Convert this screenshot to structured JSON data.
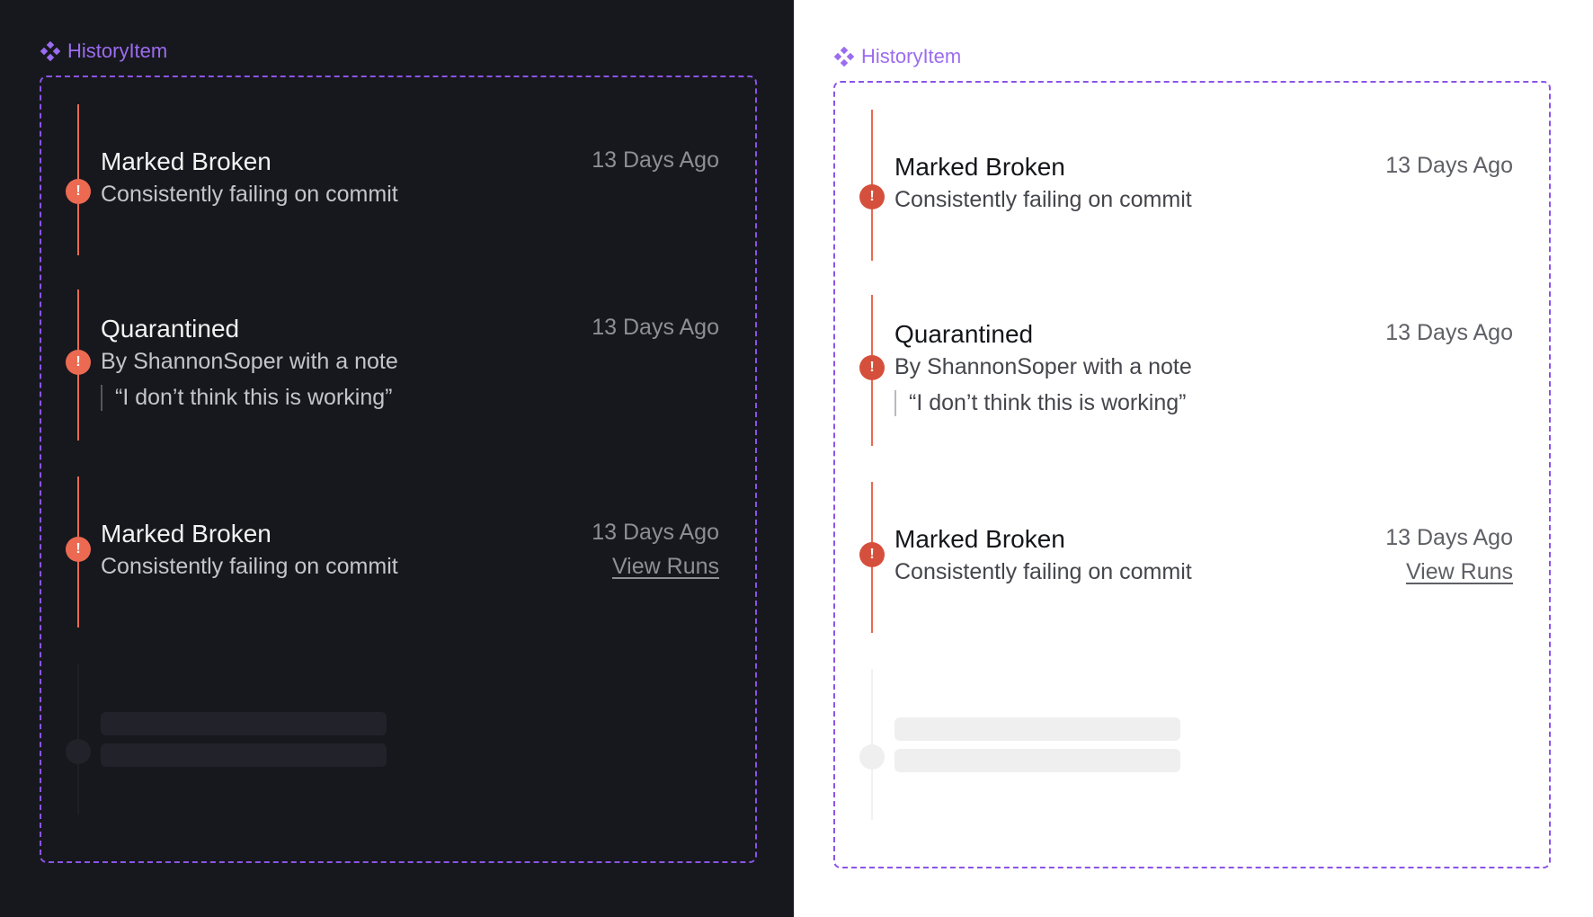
{
  "component_label": "HistoryItem",
  "colors": {
    "accent_purple": "#8b54e8",
    "status_red_dark": "#ec6a52",
    "status_red_light": "#d5503c",
    "dark_background": "#17181d",
    "light_background": "#ffffff"
  },
  "icons": {
    "component": "component-diamond-icon",
    "status": "alert-exclamation-icon"
  },
  "items": [
    {
      "title": "Marked Broken",
      "subtitle": "Consistently failing on commit",
      "time": "13 Days Ago"
    },
    {
      "title": "Quarantined",
      "subtitle": "By ShannonSoper with a note",
      "note": "“I don’t think this is working”",
      "time": "13 Days Ago"
    },
    {
      "title": "Marked Broken",
      "subtitle": "Consistently failing on commit",
      "time": "13 Days Ago",
      "link": "View Runs"
    }
  ],
  "status_glyph": "!"
}
